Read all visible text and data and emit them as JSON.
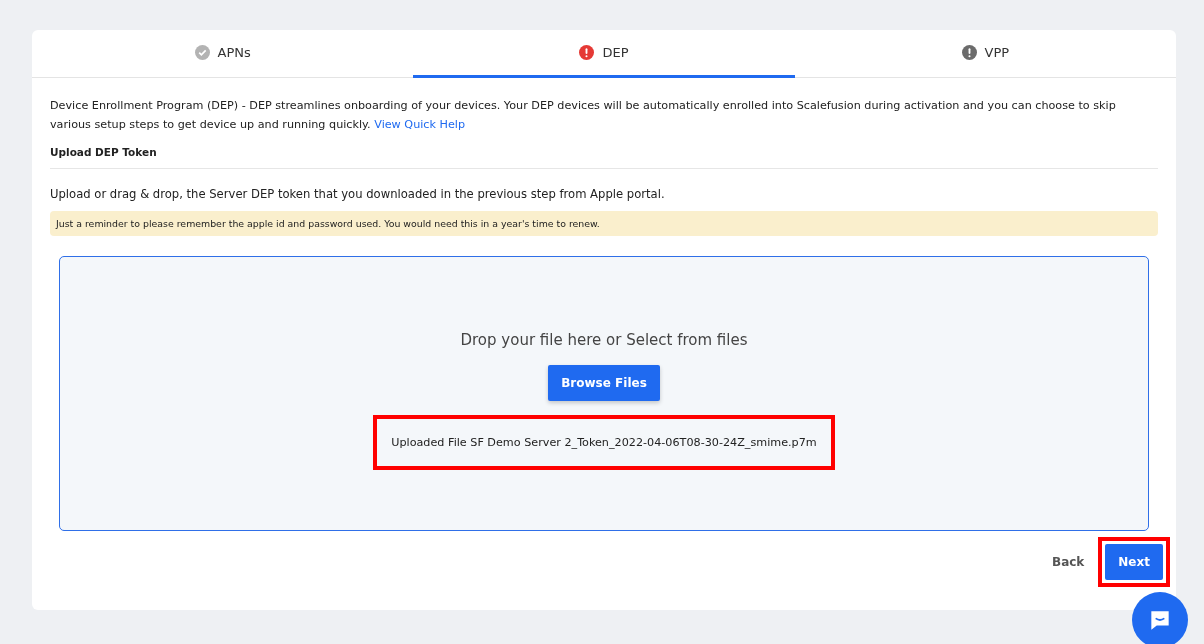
{
  "tabs": [
    {
      "label": "APNs",
      "kind": "done",
      "selected": false
    },
    {
      "label": "DEP",
      "kind": "error",
      "selected": true
    },
    {
      "label": "VPP",
      "kind": "pending",
      "selected": false
    }
  ],
  "intro": {
    "text": "Device Enrollment Program (DEP) - DEP streamlines onboarding of your devices. Your DEP devices will be automatically enrolled into Scalefusion during activation and you can choose to skip various setup steps to get device up and running quickly.",
    "link": "View Quick Help"
  },
  "section_title": "Upload DEP Token",
  "instruction": "Upload or drag & drop, the Server DEP token that you downloaded in the previous step from Apple portal.",
  "reminder": "Just a reminder to please remember the apple id and password used. You would need this in a year's time to renew.",
  "dropzone": {
    "prompt": "Drop your file here or Select from files",
    "button": "Browse Files",
    "uploaded": {
      "text": "Uploaded File SF Demo Server 2_Token_2022-04-06T08-30-24Z_smime.p7m",
      "highlighted": true
    }
  },
  "footer": {
    "back": "Back",
    "next": {
      "label": "Next",
      "highlighted": true
    }
  }
}
